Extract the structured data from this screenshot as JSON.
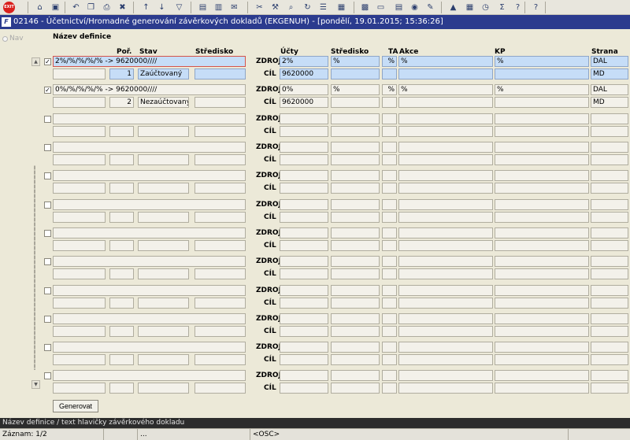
{
  "toolbar": {
    "icons": [
      "exit-icon",
      "home-icon",
      "save-icon",
      "undo-icon",
      "copy-icon",
      "print-icon",
      "delete-icon",
      "sort-asc-icon",
      "sort-desc-icon",
      "filter-icon",
      "print-preview-icon",
      "print-setup-icon",
      "mail-icon",
      "cut-icon",
      "tools-icon",
      "find-icon",
      "refresh-icon",
      "list-icon",
      "columns-icon",
      "chart-icon",
      "document-icon",
      "report-icon",
      "globe-icon",
      "edit-icon",
      "warning-icon",
      "calculator-icon",
      "clock-icon",
      "sum-icon",
      "help-icon",
      "about-icon"
    ],
    "exit_label": "EXIT"
  },
  "window": {
    "logo": "F",
    "title": "02146 - Účetnictví/Hromadné generování závěrkových dokladů (EKGENUH) - [pondělí, 19.01.2015; 15:36:26]"
  },
  "nav": {
    "label": "Nav"
  },
  "headers": {
    "nazev": "Název definice",
    "por": "Poř.",
    "stav": "Stav",
    "stredisko_left": "Středisko",
    "ucty": "Účty",
    "stredisko_right": "Středisko",
    "ta": "TA",
    "akce": "Akce",
    "kp": "KP",
    "strana": "Strana"
  },
  "labels": {
    "zdroj": "ZDROJ",
    "cil": "CÍL"
  },
  "records": [
    {
      "checked": true,
      "name": "2%/%/%/%/% -> 9620000////",
      "por": "1",
      "stav": "Zaúčtovaný",
      "stredisko": "",
      "zdroj": {
        "ucty": "2%",
        "stredisko": "%",
        "ta": "%",
        "akce": "%",
        "kp": "%",
        "strana": "DAL"
      },
      "cil": {
        "ucty": "9620000",
        "stredisko": "",
        "ta": "",
        "akce": "",
        "kp": "",
        "strana": "MD"
      }
    },
    {
      "checked": true,
      "name": "0%/%/%/%/% -> 9620000////",
      "por": "2",
      "stav": "Nezaúčtovaný",
      "stredisko": "",
      "zdroj": {
        "ucty": "0%",
        "stredisko": "%",
        "ta": "%",
        "akce": "%",
        "kp": "%",
        "strana": "DAL"
      },
      "cil": {
        "ucty": "9620000",
        "stredisko": "",
        "ta": "",
        "akce": "",
        "kp": "",
        "strana": "MD"
      }
    },
    {
      "checked": false,
      "name": "",
      "por": "",
      "stav": "",
      "stredisko": "",
      "zdroj": {
        "ucty": "",
        "stredisko": "",
        "ta": "",
        "akce": "",
        "kp": "",
        "strana": ""
      },
      "cil": {
        "ucty": "",
        "stredisko": "",
        "ta": "",
        "akce": "",
        "kp": "",
        "strana": ""
      }
    },
    {
      "checked": false,
      "name": "",
      "por": "",
      "stav": "",
      "stredisko": "",
      "zdroj": {
        "ucty": "",
        "stredisko": "",
        "ta": "",
        "akce": "",
        "kp": "",
        "strana": ""
      },
      "cil": {
        "ucty": "",
        "stredisko": "",
        "ta": "",
        "akce": "",
        "kp": "",
        "strana": ""
      }
    },
    {
      "checked": false,
      "name": "",
      "por": "",
      "stav": "",
      "stredisko": "",
      "zdroj": {
        "ucty": "",
        "stredisko": "",
        "ta": "",
        "akce": "",
        "kp": "",
        "strana": ""
      },
      "cil": {
        "ucty": "",
        "stredisko": "",
        "ta": "",
        "akce": "",
        "kp": "",
        "strana": ""
      }
    },
    {
      "checked": false,
      "name": "",
      "por": "",
      "stav": "",
      "stredisko": "",
      "zdroj": {
        "ucty": "",
        "stredisko": "",
        "ta": "",
        "akce": "",
        "kp": "",
        "strana": ""
      },
      "cil": {
        "ucty": "",
        "stredisko": "",
        "ta": "",
        "akce": "",
        "kp": "",
        "strana": ""
      }
    },
    {
      "checked": false,
      "name": "",
      "por": "",
      "stav": "",
      "stredisko": "",
      "zdroj": {
        "ucty": "",
        "stredisko": "",
        "ta": "",
        "akce": "",
        "kp": "",
        "strana": ""
      },
      "cil": {
        "ucty": "",
        "stredisko": "",
        "ta": "",
        "akce": "",
        "kp": "",
        "strana": ""
      }
    },
    {
      "checked": false,
      "name": "",
      "por": "",
      "stav": "",
      "stredisko": "",
      "zdroj": {
        "ucty": "",
        "stredisko": "",
        "ta": "",
        "akce": "",
        "kp": "",
        "strana": ""
      },
      "cil": {
        "ucty": "",
        "stredisko": "",
        "ta": "",
        "akce": "",
        "kp": "",
        "strana": ""
      }
    },
    {
      "checked": false,
      "name": "",
      "por": "",
      "stav": "",
      "stredisko": "",
      "zdroj": {
        "ucty": "",
        "stredisko": "",
        "ta": "",
        "akce": "",
        "kp": "",
        "strana": ""
      },
      "cil": {
        "ucty": "",
        "stredisko": "",
        "ta": "",
        "akce": "",
        "kp": "",
        "strana": ""
      }
    },
    {
      "checked": false,
      "name": "",
      "por": "",
      "stav": "",
      "stredisko": "",
      "zdroj": {
        "ucty": "",
        "stredisko": "",
        "ta": "",
        "akce": "",
        "kp": "",
        "strana": ""
      },
      "cil": {
        "ucty": "",
        "stredisko": "",
        "ta": "",
        "akce": "",
        "kp": "",
        "strana": ""
      }
    },
    {
      "checked": false,
      "name": "",
      "por": "",
      "stav": "",
      "stredisko": "",
      "zdroj": {
        "ucty": "",
        "stredisko": "",
        "ta": "",
        "akce": "",
        "kp": "",
        "strana": ""
      },
      "cil": {
        "ucty": "",
        "stredisko": "",
        "ta": "",
        "akce": "",
        "kp": "",
        "strana": ""
      }
    },
    {
      "checked": false,
      "name": "",
      "por": "",
      "stav": "",
      "stredisko": "",
      "zdroj": {
        "ucty": "",
        "stredisko": "",
        "ta": "",
        "akce": "",
        "kp": "",
        "strana": ""
      },
      "cil": {
        "ucty": "",
        "stredisko": "",
        "ta": "",
        "akce": "",
        "kp": "",
        "strana": ""
      }
    }
  ],
  "buttons": {
    "generovat": "Generovat"
  },
  "hint": "Název definice / text hlavičky závěrkového dokladu",
  "status": {
    "zaznam": "Záznam: 1/2",
    "dots": "...",
    "mode": "<OSC>"
  },
  "colors": {
    "title_bar": "#2b3b8e",
    "active_row": "#c6ddf7",
    "focus_border": "#d4544b",
    "hint_bar": "#2c2c2c"
  }
}
